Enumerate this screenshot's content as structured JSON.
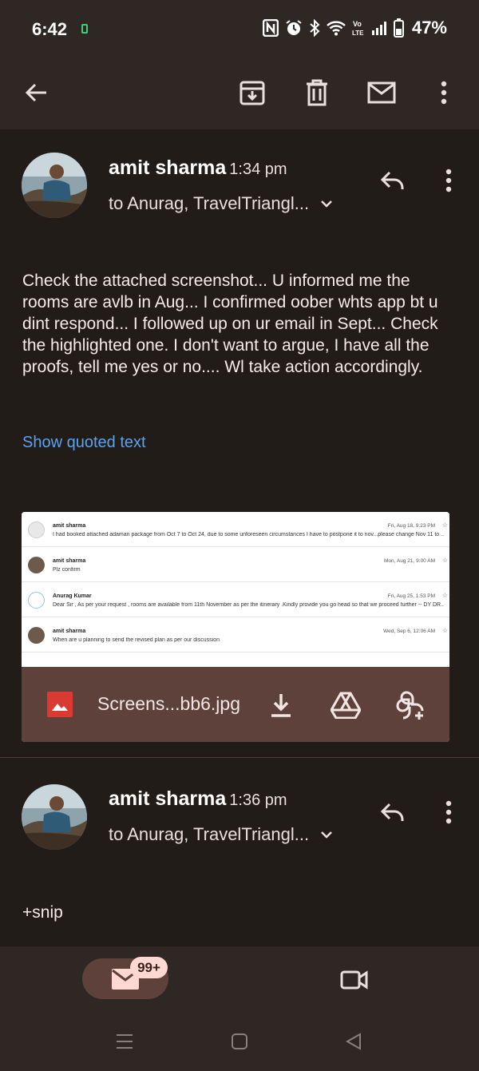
{
  "status_bar": {
    "time": "6:42",
    "battery_percent": "47%",
    "icons": [
      "battery-charging-icon",
      "nfc-icon",
      "alarm-icon",
      "bluetooth-icon",
      "wifi-icon",
      "volte-icon",
      "signal-icon",
      "battery-icon"
    ]
  },
  "toolbar": {
    "icons": [
      "back-arrow-icon",
      "archive-icon",
      "delete-icon",
      "mark-unread-icon",
      "more-vert-icon"
    ]
  },
  "messages": [
    {
      "sender": "amit sharma",
      "time": "1:34 pm",
      "recipients": "to Anurag, TravelTriangl...",
      "body": "Check the attached screenshot... U informed me the rooms are avlb in Aug... I confirmed oober whts app bt u dint respond... I followed up on ur email in Sept... Check the highlighted one. I don't want to argue, I have all the proofs, tell me yes or no.... Wl take action accordingly.",
      "quoted_link": "Show quoted text",
      "attachment": {
        "filename": "Screens...bb6.jpg",
        "preview_rows": [
          {
            "name": "amit sharma",
            "snippet": "I had booked attached adaman package from Oct 7 to Oct 24, due to some unforeseen circumstances I have to postpone it to nov...please change Nov 11 to ...",
            "date": "Fri, Aug 18, 9:23 PM"
          },
          {
            "name": "amit sharma",
            "snippet": "Plz confirm",
            "date": "Mon, Aug 21, 9:00 AM"
          },
          {
            "name": "Anurag Kumar",
            "snippet": "Dear Sir , As per your request , rooms are available from 11th November as per the itinerary .Kindly provide you go head so that we proceed further -- DY DR...",
            "date": "Fri, Aug 25, 1:53 PM"
          },
          {
            "name": "amit sharma",
            "snippet": "When are u planning to send the revised plan as per our discussion",
            "date": "Wed, Sep 6, 12:06 AM"
          }
        ]
      }
    },
    {
      "sender": "amit sharma",
      "time": "1:36 pm",
      "recipients": "to Anurag, TravelTriangl...",
      "body": "+snip"
    }
  ],
  "bottom_nav": {
    "mail_badge": "99+"
  },
  "colors": {
    "background": "#221c19",
    "bar": "#2f2724",
    "accent_link": "#5aa2f2",
    "attachment_bar": "#5e413b",
    "badge": "#ffd8d3"
  }
}
